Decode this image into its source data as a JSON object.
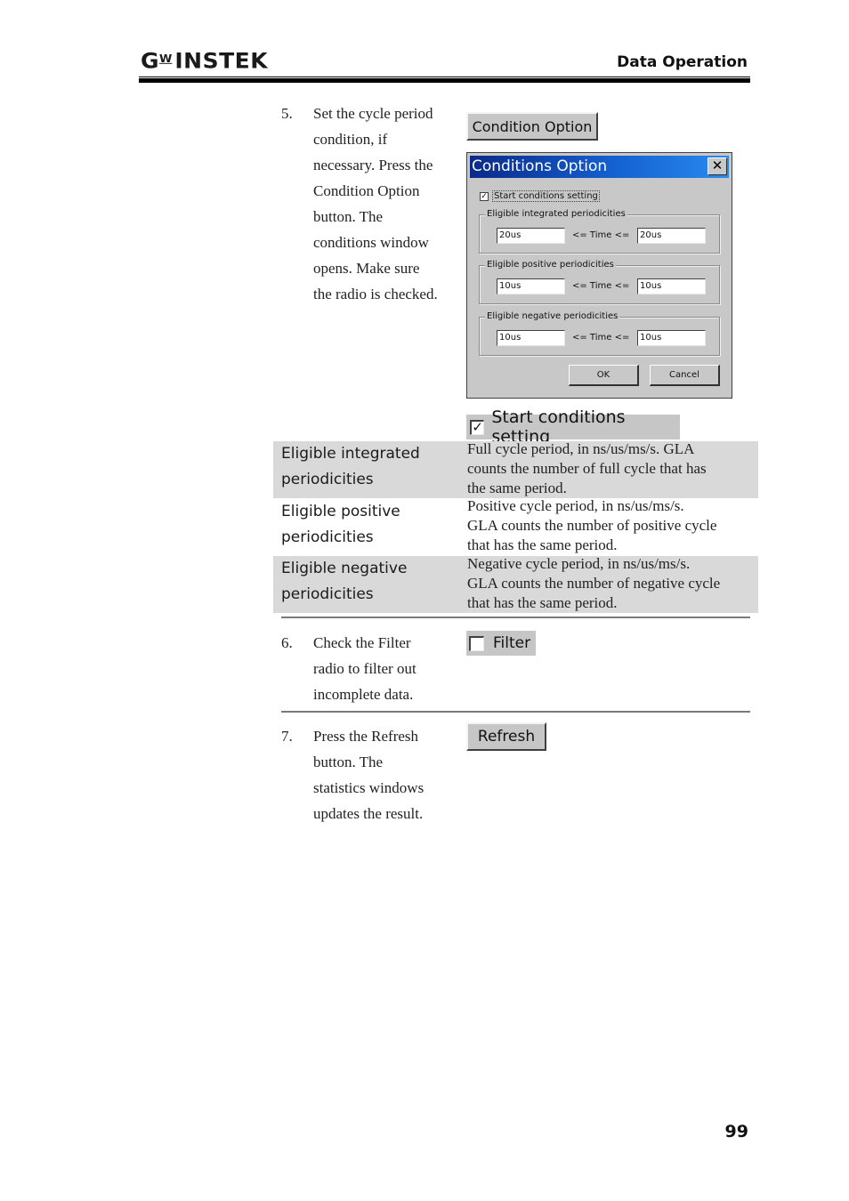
{
  "header": {
    "logo_main": "G",
    "logo_sup": "W",
    "logo_rest": "INSTEK",
    "section_title": "Data Operation"
  },
  "steps": [
    {
      "number": "5.",
      "lines": [
        "Set the cycle period",
        "condition, if",
        "necessary. Press the",
        "Condition Option",
        "button. The",
        "conditions window",
        "opens. Make sure",
        "the radio is checked."
      ]
    },
    {
      "number": "6.",
      "lines": [
        "Check the Filter",
        "radio to filter out",
        "incomplete data."
      ]
    },
    {
      "number": "7.",
      "lines": [
        "Press the Refresh",
        "button. The",
        "statistics windows",
        "updates the result."
      ]
    }
  ],
  "condition_option_button": {
    "label": "Condition Option"
  },
  "dialog": {
    "title": "Conditions Option",
    "close_glyph": "✕",
    "start_checkbox": {
      "label": "Start conditions setting",
      "checked": true
    },
    "groups": [
      {
        "label": "Eligible integrated periodicities",
        "min": "20us",
        "relation": "<= Time <=",
        "max": "20us"
      },
      {
        "label": "Eligible positive periodicities",
        "min": "10us",
        "relation": "<= Time <=",
        "max": "10us"
      },
      {
        "label": "Eligible negative periodicities",
        "min": "10us",
        "relation": "<= Time <=",
        "max": "10us"
      }
    ],
    "ok_label": "OK",
    "cancel_label": "Cancel"
  },
  "start_conditions_snippet": {
    "label": "Start conditions setting",
    "checked": true,
    "check_glyph": "✓"
  },
  "table": {
    "rows": [
      {
        "term_lines": [
          "Eligible integrated",
          "periodicities"
        ],
        "desc_lines": [
          "Full cycle period, in ns/us/ms/s. GLA",
          "counts the number of  full cycle that has",
          "the same period."
        ]
      },
      {
        "term_lines": [
          "Eligible positive",
          "periodicities"
        ],
        "desc_lines": [
          "Positive cycle period, in ns/us/ms/s.",
          "GLA counts the number of  positive cycle",
          "that has the same period."
        ]
      },
      {
        "term_lines": [
          "Eligible negative",
          "periodicities"
        ],
        "desc_lines": [
          "Negative cycle period, in ns/us/ms/s.",
          "GLA counts the number of  negative cycle",
          "that has the same period."
        ]
      }
    ]
  },
  "filter_snippet": {
    "label": "Filter",
    "checked": false
  },
  "refresh_button": {
    "label": "Refresh"
  },
  "footer": {
    "page_number": "99"
  }
}
